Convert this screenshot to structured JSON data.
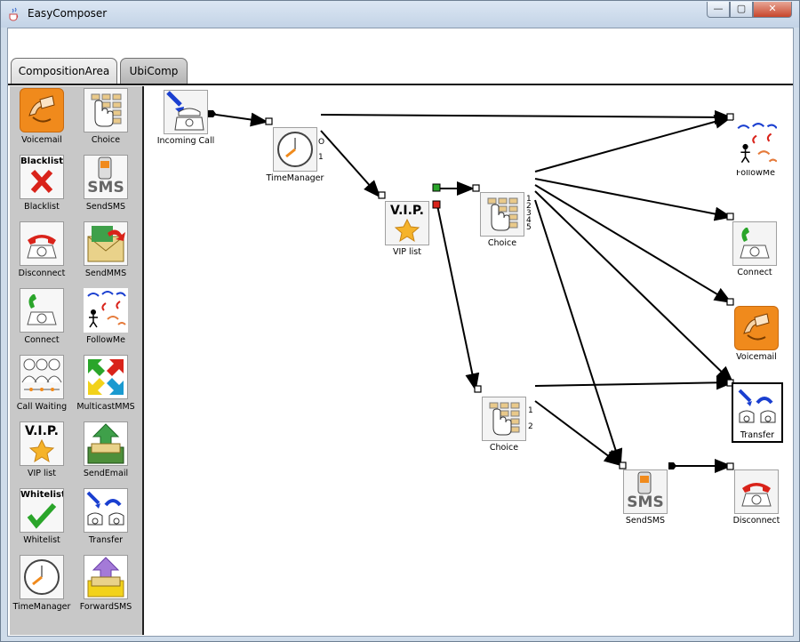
{
  "window": {
    "title": "EasyComposer",
    "min_glyph": "—",
    "max_glyph": "▢",
    "close_glyph": "✕"
  },
  "tabs": [
    {
      "label": "CompositionArea"
    },
    {
      "label": "UbiComp"
    }
  ],
  "palette": {
    "items": [
      {
        "label": "Voicemail",
        "icon": "voicemail-icon"
      },
      {
        "label": "Choice",
        "icon": "choice-keypad-icon"
      },
      {
        "label": "Blacklist",
        "icon": "blacklist-icon",
        "icon_text": "Blacklist"
      },
      {
        "label": "SendSMS",
        "icon": "sms-phone-icon",
        "icon_text": "SMS"
      },
      {
        "label": "Disconnect",
        "icon": "red-phone-icon"
      },
      {
        "label": "SendMMS",
        "icon": "mms-envelope-icon"
      },
      {
        "label": "Connect",
        "icon": "green-phone-icon"
      },
      {
        "label": "FollowMe",
        "icon": "followme-icon"
      },
      {
        "label": "Call Waiting",
        "icon": "call-waiting-icon"
      },
      {
        "label": "MulticastMMS",
        "icon": "multicast-arrows-icon"
      },
      {
        "label": "VIP list",
        "icon": "vip-icon",
        "icon_text": "V.I.P."
      },
      {
        "label": "SendEmail",
        "icon": "email-icon"
      },
      {
        "label": "Whitelist",
        "icon": "whitelist-icon",
        "icon_text": "Whitelist"
      },
      {
        "label": "Transfer",
        "icon": "transfer-icon"
      },
      {
        "label": "TimeManager",
        "icon": "clock-icon"
      },
      {
        "label": "ForwardSMS",
        "icon": "forward-sms-icon"
      }
    ]
  },
  "canvas": {
    "nodes": {
      "incoming_call": {
        "label": "Incoming Call"
      },
      "time_manager": {
        "label": "TimeManager",
        "ports": [
          "O",
          "1"
        ]
      },
      "vip_list": {
        "label": "VIP list",
        "icon_text": "V.I.P."
      },
      "choice_top": {
        "label": "Choice",
        "ports": [
          "1",
          "2",
          "3",
          "4",
          "5"
        ]
      },
      "choice_bottom": {
        "label": "Choice",
        "ports": [
          "1",
          "2"
        ]
      },
      "followme": {
        "label": "FollowMe"
      },
      "connect": {
        "label": "Connect"
      },
      "voicemail": {
        "label": "Voicemail"
      },
      "transfer": {
        "label": "Transfer"
      },
      "send_sms": {
        "label": "SendSMS",
        "icon_text": "SMS"
      },
      "disconnect": {
        "label": "Disconnect"
      }
    }
  },
  "colors": {
    "accent_orange": "#f08a1c",
    "phone_red": "#d9231a",
    "phone_green": "#2aa52a",
    "arrow_blue": "#1a3fd0"
  }
}
